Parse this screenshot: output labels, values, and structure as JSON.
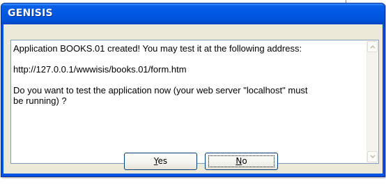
{
  "dialog": {
    "title": "GENISIS",
    "message": {
      "line1": "Application BOOKS.01 created! You may test it at the following address:",
      "line2": "http://127.0.0.1/wwwisis/books.01/form.htm",
      "line3": "Do you want to test the application now (your web server \"localhost\" must",
      "line4": "be running) ?"
    },
    "buttons": {
      "yes": {
        "mnemonic": "Y",
        "rest": "es"
      },
      "no": {
        "mnemonic": "N",
        "rest": "o"
      }
    },
    "default_button": "no"
  },
  "colors": {
    "titlebar": "#0054e3",
    "dialog_face": "#ece9d8",
    "button_border": "#003c74"
  },
  "icons": [
    "scroll-up-arrow-icon",
    "scroll-down-arrow-icon"
  ]
}
